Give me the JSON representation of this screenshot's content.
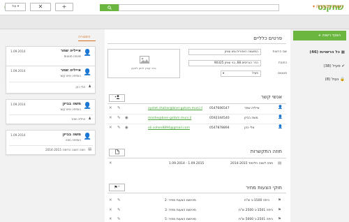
{
  "topbar": {
    "logo": "שחקנט",
    "search_placeholder": "",
    "icons": [
      "search-icon",
      "bell-icon",
      "gear-icon",
      "grid-icon",
      "avatar-icon"
    ]
  },
  "subbar": {
    "title": "רשויות מקומיות",
    "more_label": "עוד",
    "buttons": [
      "+",
      "✕"
    ]
  },
  "sidebar": {
    "new_label": "+ הוסף רשות",
    "items": [
      {
        "label": "כל הרשויות (46)"
      },
      {
        "label": "פעיל (38)"
      },
      {
        "label": "נעול (8)"
      }
    ]
  },
  "general": {
    "title": "פרטים כלליים",
    "image_text": "גרור קובץ לכאן לטעון",
    "fields": [
      {
        "label": "שם הרשות",
        "value": "המועצה האזורית גוש עציון"
      },
      {
        "label": "כתובת",
        "value": "הדר הגריסים 68, בני עציון 90325"
      },
      {
        "label": "סטטוס",
        "value": "פעיל"
      }
    ]
  },
  "contacts": {
    "title": "אנשי קשר",
    "rows": [
      {
        "name": "אייליה שחר",
        "phone": "0547606547",
        "email": "ayelet.shahar@bnei-gotom.muni.il"
      },
      {
        "name": "משה בביזן",
        "phone": "0592344540",
        "email": "moshe@bnei-gotom.muni.il"
      },
      {
        "name": "אלי כהן",
        "phone": "0547878894",
        "email": "eli.cohen8894@gmail.com"
      }
    ]
  },
  "contracts": {
    "title": "חוזה התקשרות",
    "rows": [
      {
        "text": "חוזה לשנה הלימוד 2014-2015",
        "dates": "1.09.2014 - 1.09.2015"
      }
    ]
  },
  "pricing": {
    "title": "חוקי הצעות מחיר",
    "rows": [
      {
        "text": "כיתה 1500-ב ש\"ח",
        "note": "מינימום הצעות מחיר: 2"
      },
      {
        "text": "כיתה 1501-ב 2500 ש\"ח",
        "note": "מינימום הצעות מחיר: 3"
      },
      {
        "text": "כיתה 2501-ב 5000 ש\"ח",
        "note": "מינימום הצעות מחיר: 5"
      }
    ]
  },
  "history": {
    "title": "היסטוריה",
    "cards": [
      {
        "name": "אייליה שחר",
        "sub": "שינתה סטטוס",
        "date": "1.09.2014",
        "foot": "פעיל"
      },
      {
        "name": "אייליה שחר",
        "sub": "הוסיפה איש קשר",
        "date": "1.09.2014",
        "foot": "אלי כהן"
      },
      {
        "name": "משה בביזן",
        "sub": "הוסיפה איש קשר",
        "date": "1.09.2014",
        "foot": "אייליה שחר"
      },
      {
        "name": "משה בביזן",
        "sub": "הוסיפה חוזה",
        "date": "1.09.2014",
        "foot": "חוזה לשנה הלימוד 2014-2015"
      }
    ]
  }
}
